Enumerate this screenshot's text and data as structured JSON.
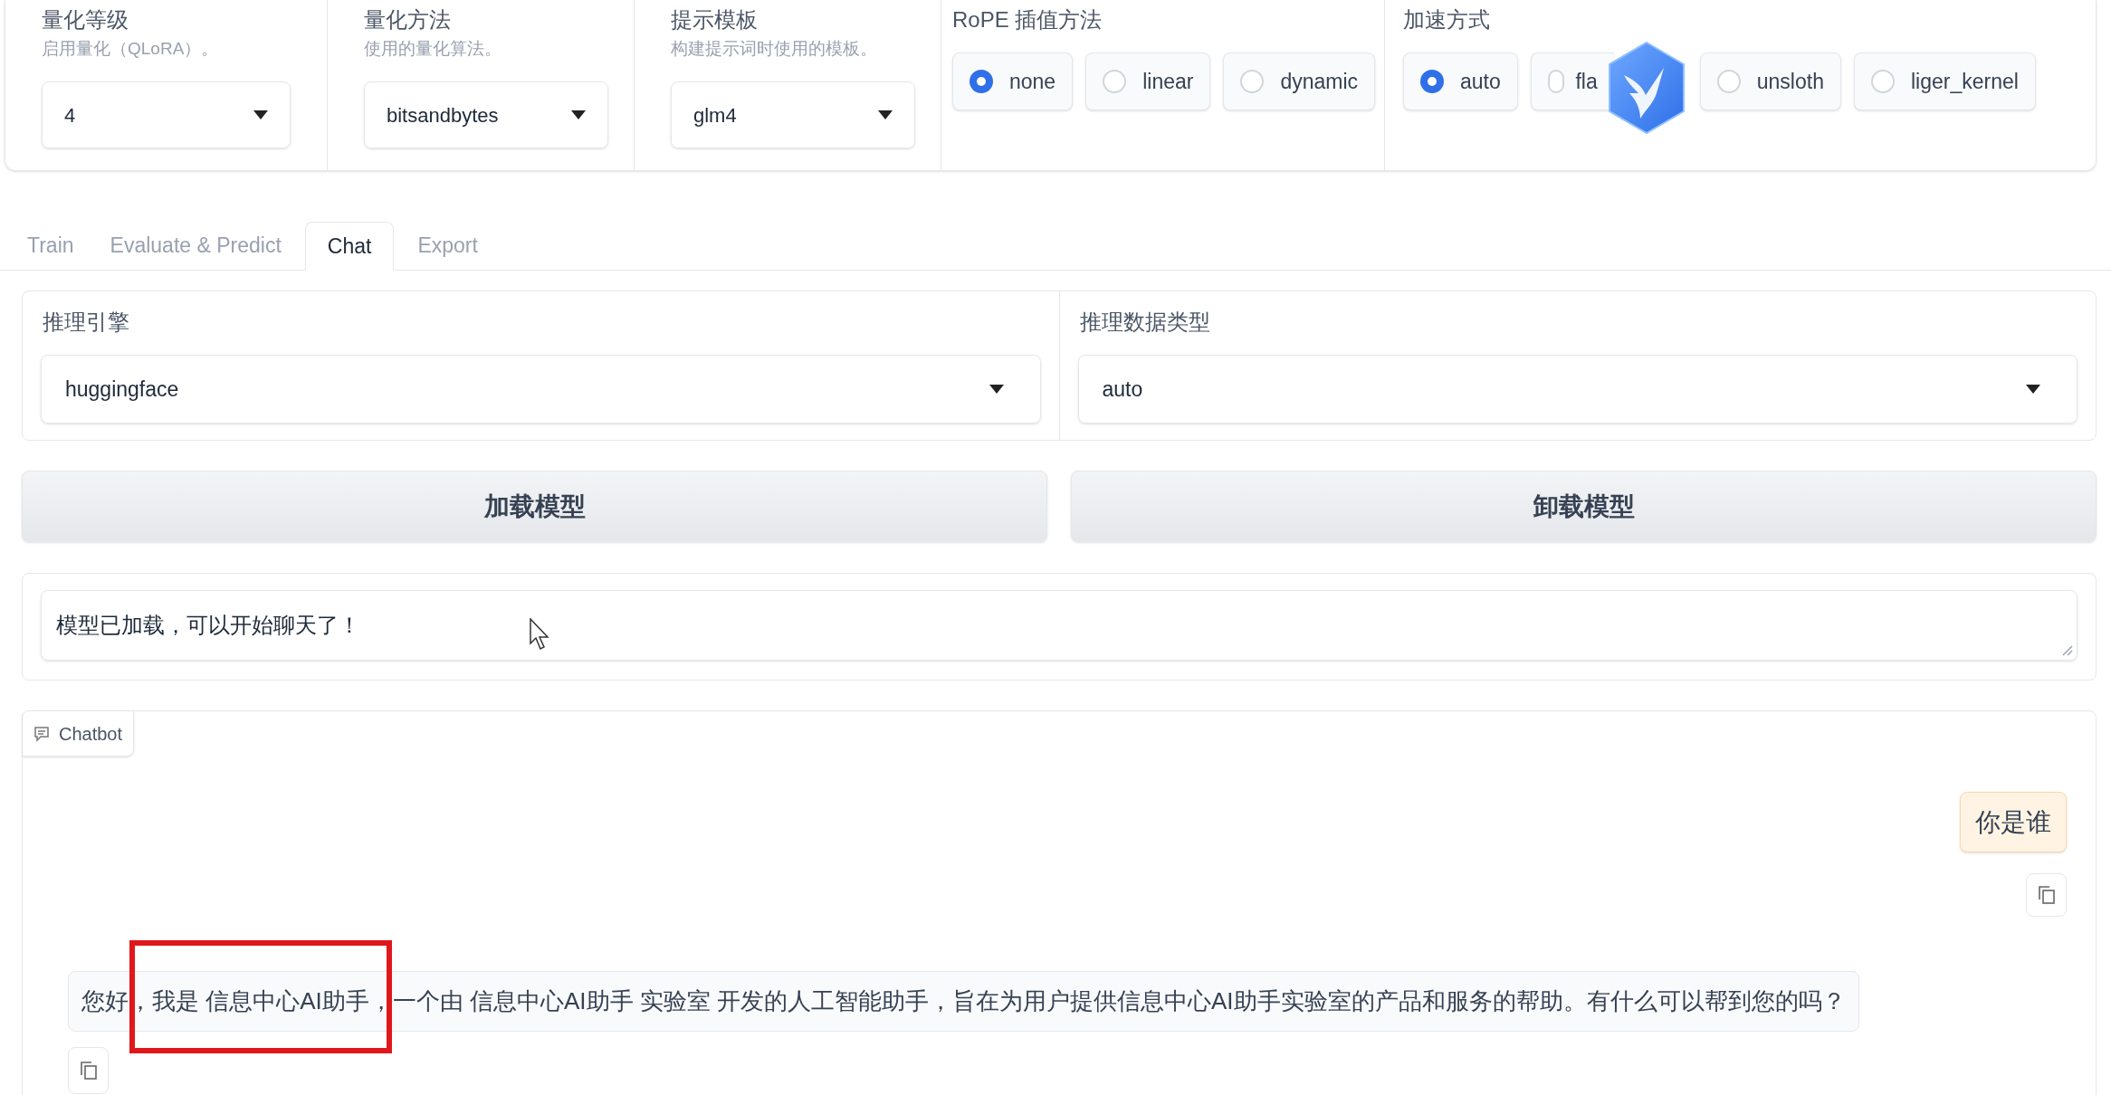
{
  "settings": [
    {
      "title": "量化等级",
      "hint": "启用量化（QLoRA）。",
      "value": "4"
    },
    {
      "title": "量化方法",
      "hint": "使用的量化算法。",
      "value": "bitsandbytes"
    },
    {
      "title": "提示模板",
      "hint": "构建提示词时使用的模板。",
      "value": "glm4"
    }
  ],
  "radio_groups": [
    {
      "title": "RoPE 插值方法",
      "options": [
        {
          "label": "none",
          "selected": true
        },
        {
          "label": "linear",
          "selected": false
        },
        {
          "label": "dynamic",
          "selected": false
        }
      ]
    },
    {
      "title": "加速方式",
      "options": [
        {
          "label": "auto",
          "selected": true
        },
        {
          "label": "fla",
          "selected": false
        },
        {
          "label": "unsloth",
          "selected": false
        },
        {
          "label": "liger_kernel",
          "selected": false
        }
      ]
    }
  ],
  "tabs": [
    {
      "label": "Train",
      "selected": false
    },
    {
      "label": "Evaluate & Predict",
      "selected": false
    },
    {
      "label": "Chat",
      "selected": true
    },
    {
      "label": "Export",
      "selected": false
    }
  ],
  "dropdowns": [
    {
      "label": "推理引擎",
      "value": "huggingface"
    },
    {
      "label": "推理数据类型",
      "value": "auto"
    }
  ],
  "buttons": [
    "加载模型",
    "卸载模型"
  ],
  "status": {
    "value": "模型已加载，可以开始聊天了！"
  },
  "chatbot": {
    "label": "Chatbot",
    "messages": [
      {
        "kind": "user",
        "text": "你是谁"
      },
      {
        "kind": "assistant",
        "text": "您好，我是 信息中心AI助手，一个由 信息中心AI助手 实验室 开发的人工智能助手，旨在为用户提供信息中心AI助手实验室的产品和服务的帮助。有什么可以帮到您的吗？"
      }
    ]
  }
}
